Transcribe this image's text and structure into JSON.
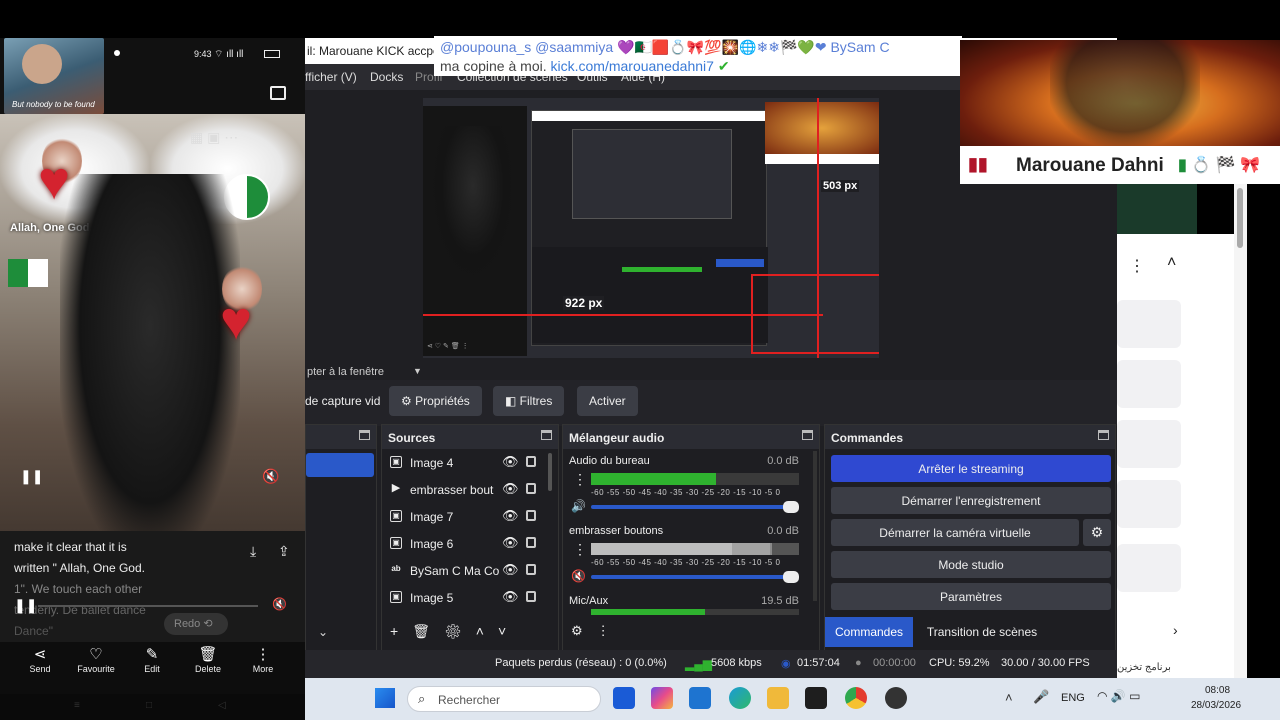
{
  "phone": {
    "status_time": "9:43",
    "avatar_caption": "But nobody to be found",
    "photo_caption": "Allah, One God.",
    "caption_lines": [
      "make it clear that it is",
      "written \" Allah, One God.",
      "1\". We touch each other",
      "tenderly. De ballet dance",
      "Dance\""
    ],
    "redo_label": "Redo",
    "actions": [
      {
        "label": "Send",
        "icon": "share-icon"
      },
      {
        "label": "Favourite",
        "icon": "heart-icon"
      },
      {
        "label": "Edit",
        "icon": "edit-icon"
      },
      {
        "label": "Delete",
        "icon": "trash-icon"
      },
      {
        "label": "More",
        "icon": "more-vertical-icon"
      }
    ]
  },
  "obs": {
    "window_title": "il: Marouane KICK accpetab",
    "menu": [
      "fficher (V)",
      "Docks",
      "Profil",
      "Collection de scènes",
      "Outils",
      "Aide (H)"
    ],
    "preview_label": "pter à la fenêtre",
    "preview_dims": {
      "w_label": "922 px",
      "h_label": "503 px"
    },
    "toolbar": {
      "source_label": "de capture vid",
      "props_label": "Propriétés",
      "filters_label": "Filtres",
      "activate_label": "Activer"
    },
    "sources": {
      "title": "Sources",
      "items": [
        {
          "label": "Image 4",
          "icon": "image-icon"
        },
        {
          "label": "embrasser bout",
          "icon": "play-icon"
        },
        {
          "label": "Image 7",
          "icon": "image-icon"
        },
        {
          "label": "Image 6",
          "icon": "image-icon"
        },
        {
          "label": "BySam C Ma Co",
          "icon": "text-icon"
        },
        {
          "label": "Image 5",
          "icon": "image-icon"
        }
      ]
    },
    "mixer": {
      "title": "Mélangeur audio",
      "scale": "-60 -55 -50 -45 -40 -35 -30 -25 -20 -15 -10 -5 0",
      "tracks": [
        {
          "name": "Audio du bureau",
          "db": "0.0 dB",
          "level": 0.6
        },
        {
          "name": "embrasser boutons",
          "db": "0.0 dB",
          "level": 0.87
        },
        {
          "name": "Mic/Aux",
          "db": "19.5 dB",
          "level": 0.55
        }
      ]
    },
    "commands": {
      "title": "Commandes",
      "buttons": [
        "Arrêter le streaming",
        "Démarrer l'enregistrement",
        "Démarrer la caméra virtuelle",
        "Mode studio",
        "Paramètres"
      ],
      "tabs": [
        "Commandes",
        "Transition de scènes"
      ]
    },
    "status": {
      "dropped": "Paquets perdus (réseau) : 0 (0.0%)",
      "bitrate": "5608 kbps",
      "stream_time": "01:57:04",
      "rec_time": "00:00:00",
      "cpu": "CPU: 59.2%",
      "fps": "30.00 / 30.00 FPS"
    }
  },
  "overlays": {
    "chat_line1": "@poupouna_s  @saammiya 💜🇩🇿🟥💍🎀💯🎇🌐❄❄🏁💚❤ BySam C",
    "chat_line2_prefix": "ma copine à moi. ",
    "chat_link": "kick.com/marouanedahni7",
    "nameplate": "Marouane Dahni"
  },
  "browser": {
    "rtl_text": "برنامج تخزين"
  },
  "taskbar": {
    "search_placeholder": "Rechercher",
    "lang": "ENG",
    "time": "08:08",
    "date": "28/03/2026"
  },
  "colors": {
    "accent": "#2a59c9",
    "obs_bg": "#1f1f23",
    "streaming_button": "#2f49d1"
  }
}
